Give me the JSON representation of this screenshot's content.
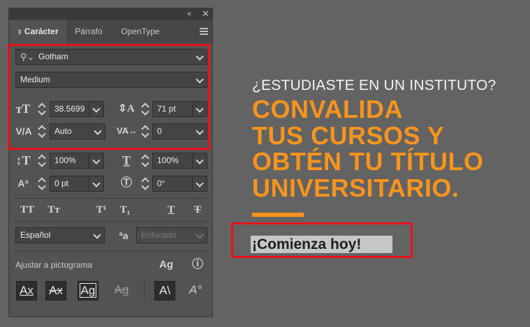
{
  "panel": {
    "tabs": [
      {
        "label": "Carácter",
        "active": true
      },
      {
        "label": "Párrafo",
        "active": false
      },
      {
        "label": "OpenType",
        "active": false
      }
    ],
    "font_family": "Gotham",
    "font_style": "Medium",
    "font_size": "38.5699",
    "leading": "71 pt",
    "kerning": "Auto",
    "tracking": "0",
    "vertical_scale": "100%",
    "horizontal_scale": "100%",
    "baseline_shift": "0 pt",
    "rotation": "0°",
    "language": "Español",
    "antialias": "Enfocado",
    "snap_label": "Ajustar a pictograma"
  },
  "hero": {
    "question": "¿ESTUDIASTE EN UN INSTITUTO?",
    "headline_lines": [
      "CONVALIDA",
      "TUS CURSOS Y",
      "OBTÉN TU TÍTULO",
      "UNIVERSITARIO."
    ],
    "cta": "¡Comienza hoy!"
  },
  "colors": {
    "accent_orange": "#f7941d",
    "highlight_red": "#e8121b",
    "panel_bg": "#535353",
    "canvas_bg": "#636363"
  }
}
